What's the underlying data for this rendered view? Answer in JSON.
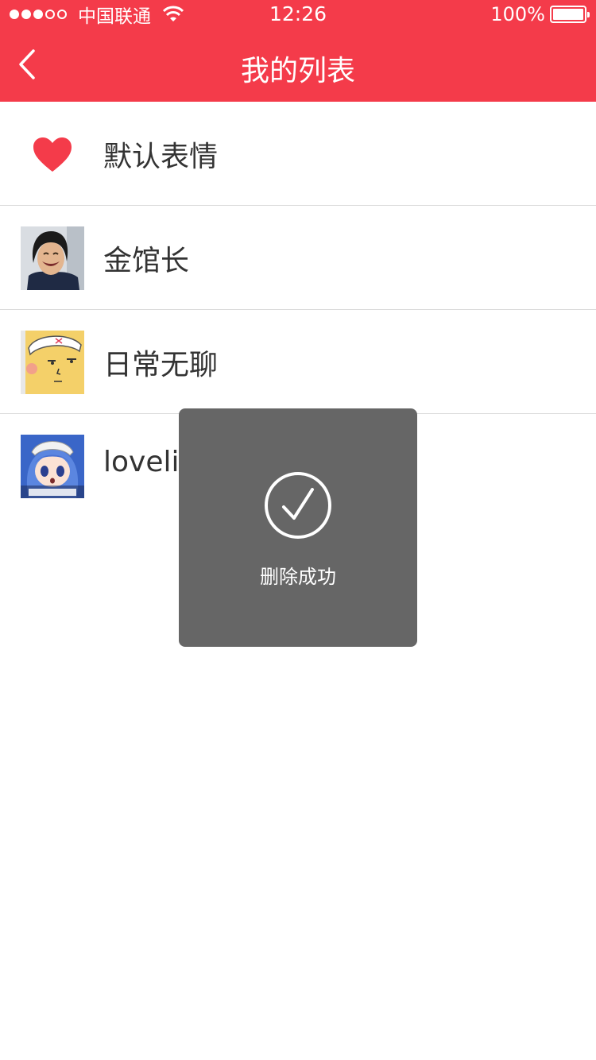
{
  "status_bar": {
    "carrier": "中国联通",
    "time": "12:26",
    "battery": "100%",
    "signal_bars_filled": 3,
    "signal_bars_total": 5
  },
  "nav": {
    "title": "我的列表",
    "back_icon": "chevron-left-icon"
  },
  "list": {
    "items": [
      {
        "label": "默认表情",
        "thumb": "heart-icon"
      },
      {
        "label": "金馆长",
        "thumb": "laughing-man-avatar"
      },
      {
        "label": "日常无聊",
        "thumb": "cartoon-face-avatar"
      },
      {
        "label": "lovelive",
        "thumb": "anime-girl-avatar"
      }
    ]
  },
  "toast": {
    "icon": "check-circle-icon",
    "message": "删除成功"
  },
  "colors": {
    "header": "#f43b4a",
    "toast_bg": "#666666",
    "heart": "#f43b4a"
  }
}
